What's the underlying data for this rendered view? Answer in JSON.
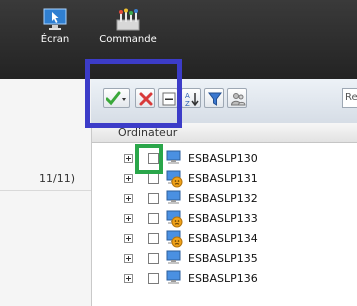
{
  "ribbon": {
    "ecran_label": "Écran",
    "commande_label": "Commande"
  },
  "left_panel": {
    "counter": "11/11)"
  },
  "toolbar": {
    "search_text": "Rec"
  },
  "list": {
    "header": "Ordinateur",
    "rows": [
      {
        "name": "ESBASLP130",
        "status": "normal"
      },
      {
        "name": "ESBASLP131",
        "status": "warning"
      },
      {
        "name": "ESBASLP132",
        "status": "normal"
      },
      {
        "name": "ESBASLP133",
        "status": "warning"
      },
      {
        "name": "ESBASLP134",
        "status": "warning"
      },
      {
        "name": "ESBASLP135",
        "status": "normal"
      },
      {
        "name": "ESBASLP136",
        "status": "normal"
      }
    ]
  },
  "colors": {
    "ribbon_bg": "#2b2b2b",
    "highlight_blue": "#3c3cc8",
    "highlight_green": "#2aa64a",
    "warning_orange": "#f0a21a"
  },
  "icons": {
    "ecran": "monitor-arrow-icon",
    "commande": "control-panel-icon",
    "validate": "green-checkmark-icon",
    "delete": "red-x-icon",
    "collapse": "minus-box-icon",
    "sort": "sort-az-icon",
    "filter": "funnel-icon",
    "users": "users-icon",
    "computer": "computer-icon"
  }
}
